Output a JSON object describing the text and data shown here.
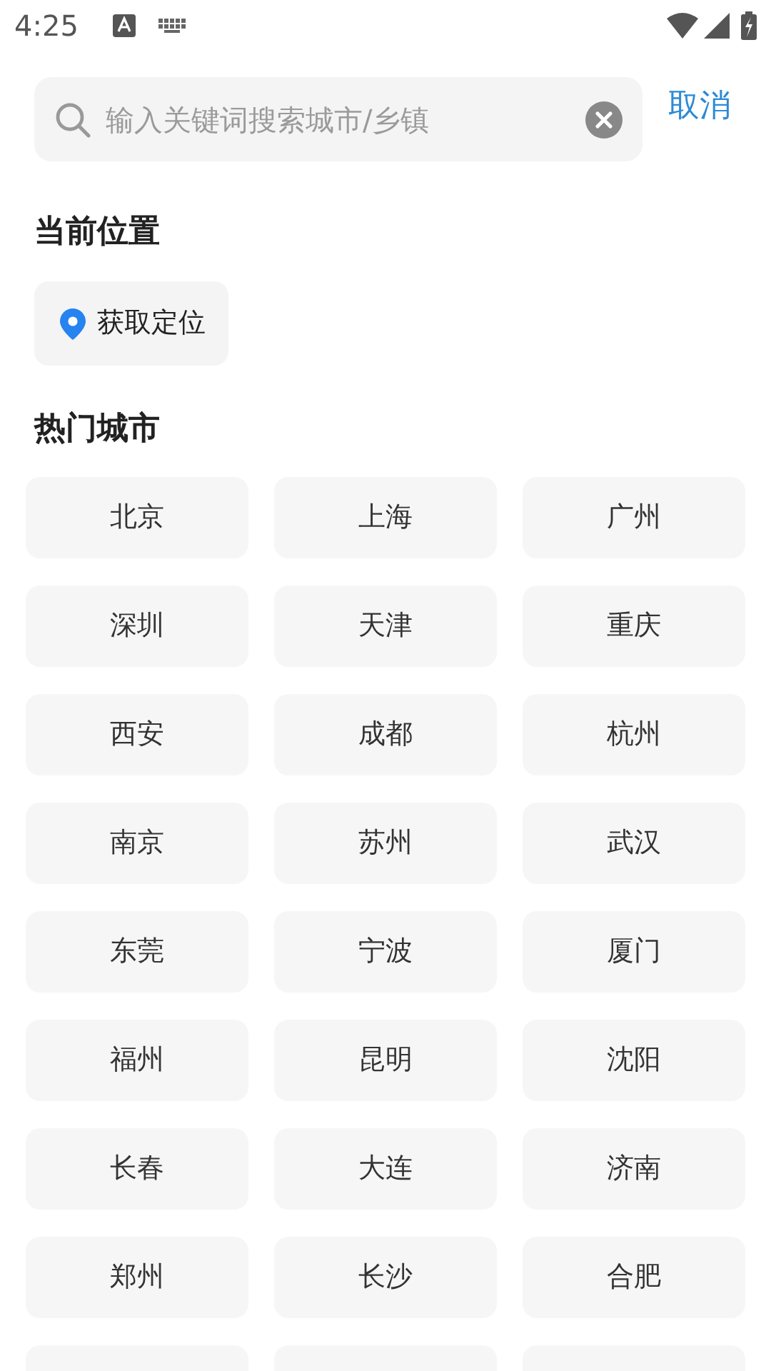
{
  "status_bar": {
    "time": "4:25"
  },
  "search": {
    "placeholder": "输入关键词搜索城市/乡镇",
    "cancel": "取消"
  },
  "current_location": {
    "title": "当前位置",
    "button": "获取定位"
  },
  "hot_cities": {
    "title": "热门城市",
    "cities": [
      {
        "kind": "city",
        "name": "北京"
      },
      {
        "kind": "city",
        "name": "上海"
      },
      {
        "kind": "city",
        "name": "广州"
      },
      {
        "kind": "city",
        "name": "深圳"
      },
      {
        "kind": "city",
        "name": "天津"
      },
      {
        "kind": "city",
        "name": "重庆"
      },
      {
        "kind": "city",
        "name": "西安"
      },
      {
        "kind": "city",
        "name": "成都"
      },
      {
        "kind": "city",
        "name": "杭州"
      },
      {
        "kind": "city",
        "name": "南京"
      },
      {
        "kind": "city",
        "name": "苏州"
      },
      {
        "kind": "city",
        "name": "武汉"
      },
      {
        "kind": "city",
        "name": "东莞"
      },
      {
        "kind": "city",
        "name": "宁波"
      },
      {
        "kind": "city",
        "name": "厦门"
      },
      {
        "kind": "city",
        "name": "福州"
      },
      {
        "kind": "city",
        "name": "昆明"
      },
      {
        "kind": "city",
        "name": "沈阳"
      },
      {
        "kind": "city",
        "name": "长春"
      },
      {
        "kind": "city",
        "name": "大连"
      },
      {
        "kind": "city",
        "name": "济南"
      },
      {
        "kind": "city",
        "name": "郑州"
      },
      {
        "kind": "city",
        "name": "长沙"
      },
      {
        "kind": "city",
        "name": "合肥"
      },
      {
        "kind": "cut"
      },
      {
        "kind": "cut"
      },
      {
        "kind": "cut"
      }
    ]
  }
}
